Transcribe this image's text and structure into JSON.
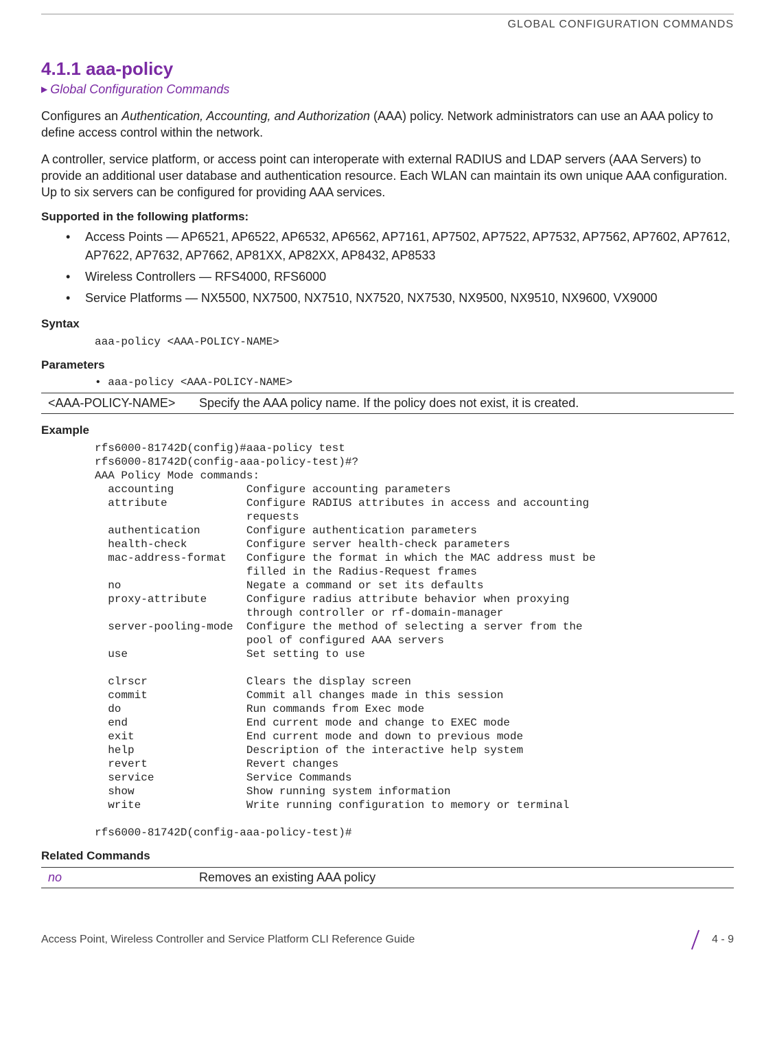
{
  "running_head": "GLOBAL CONFIGURATION COMMANDS",
  "section_number_title": "4.1.1 aaa-policy",
  "breadcrumb": "Global Configuration Commands",
  "para1_a": "Configures an ",
  "para1_em": "Authentication, Accounting, and Authorization",
  "para1_b": " (AAA) policy. Network administrators can use an AAA policy to define access control within the network.",
  "para2": "A controller, service platform, or access point can interoperate with external RADIUS and LDAP servers (AAA Servers) to provide an additional user database and authentication resource. Each WLAN can maintain its own unique AAA configuration. Up to six servers can be configured for providing AAA services.",
  "supported_head": "Supported in the following platforms:",
  "platforms": [
    "Access Points — AP6521, AP6522, AP6532, AP6562, AP7161, AP7502, AP7522, AP7532, AP7562, AP7602, AP7612, AP7622, AP7632, AP7662, AP81XX, AP82XX, AP8432, AP8533",
    "Wireless Controllers — RFS4000, RFS6000",
    "Service Platforms — NX5500, NX7500, NX7510, NX7520, NX7530, NX9500, NX9510, NX9600, VX9000"
  ],
  "syntax_head": "Syntax",
  "syntax_line": "aaa-policy <AAA-POLICY-NAME>",
  "parameters_head": "Parameters",
  "param_bullet": "• aaa-policy <AAA-POLICY-NAME>",
  "param_table": {
    "left": "<AAA-POLICY-NAME>",
    "right": "Specify the AAA policy name. If the policy does not exist, it is created."
  },
  "example_head": "Example",
  "example_block": "rfs6000-81742D(config)#aaa-policy test\nrfs6000-81742D(config-aaa-policy-test)#?\nAAA Policy Mode commands:\n  accounting           Configure accounting parameters\n  attribute            Configure RADIUS attributes in access and accounting\n                       requests\n  authentication       Configure authentication parameters\n  health-check         Configure server health-check parameters\n  mac-address-format   Configure the format in which the MAC address must be\n                       filled in the Radius-Request frames\n  no                   Negate a command or set its defaults\n  proxy-attribute      Configure radius attribute behavior when proxying\n                       through controller or rf-domain-manager\n  server-pooling-mode  Configure the method of selecting a server from the\n                       pool of configured AAA servers\n  use                  Set setting to use\n\n  clrscr               Clears the display screen\n  commit               Commit all changes made in this session\n  do                   Run commands from Exec mode\n  end                  End current mode and change to EXEC mode\n  exit                 End current mode and down to previous mode\n  help                 Description of the interactive help system\n  revert               Revert changes\n  service              Service Commands\n  show                 Show running system information\n  write                Write running configuration to memory or terminal\n\nrfs6000-81742D(config-aaa-policy-test)#",
  "related_head": "Related Commands",
  "related_table": {
    "left": "no",
    "right": "Removes an existing AAA policy"
  },
  "footer_left": "Access Point, Wireless Controller and Service Platform CLI Reference Guide",
  "footer_page": "4 - 9"
}
